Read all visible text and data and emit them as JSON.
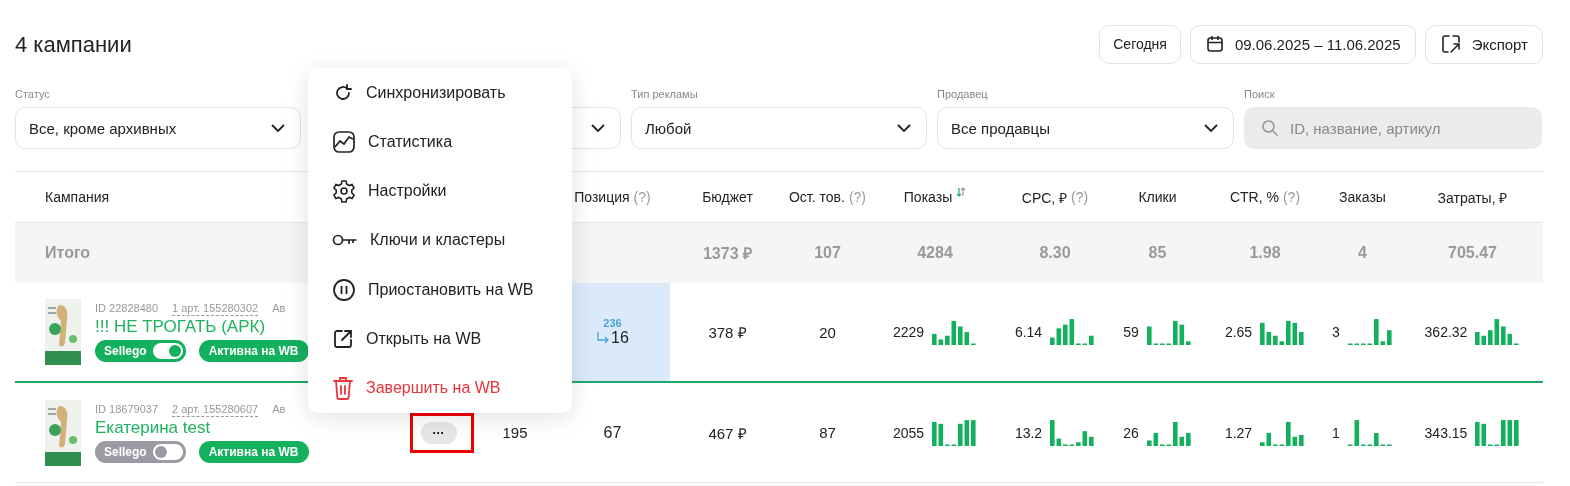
{
  "header": {
    "title": "4 кампании",
    "today_button": "Сегодня",
    "date_range": "09.06.2025 – 11.06.2025",
    "export_button": "Экспорт"
  },
  "filters": [
    {
      "kind": "select",
      "label": "Статус",
      "value": "Все, кроме архивных"
    },
    {
      "kind": "select"
    },
    {
      "kind": "select",
      "label": "Тип рекламы",
      "value": "Любой"
    },
    {
      "kind": "select",
      "label": "Продавец",
      "value": "Все продавцы"
    },
    {
      "kind": "search",
      "label": "Поиск",
      "placeholder": "ID, название, артикул"
    }
  ],
  "table": {
    "columns": [
      {
        "kind": "text",
        "label": "Кампания"
      },
      {
        "kind": "blank"
      },
      {
        "kind": "blank"
      },
      {
        "kind": "text",
        "label": "Позиция",
        "hint": "(?)"
      },
      {
        "kind": "text",
        "label": "Бюджет"
      },
      {
        "kind": "text",
        "label": "Ост. тов.",
        "hint": "(?)"
      },
      {
        "kind": "text",
        "label": "Показы",
        "sorted": true
      },
      {
        "kind": "text",
        "label": "CPC, ₽",
        "hint": "(?)"
      },
      {
        "kind": "text",
        "label": "Клики"
      },
      {
        "kind": "text",
        "label": "CTR, %",
        "hint": "(?)"
      },
      {
        "kind": "text",
        "label": "Заказы"
      },
      {
        "kind": "text",
        "label": "Затраты, ₽"
      }
    ],
    "totals": {
      "label": "Итого",
      "budget": "1373 ₽",
      "stock": "107",
      "impressions": "4284",
      "cpc": "8.30",
      "clicks": "85",
      "ctr": "1.98",
      "orders": "4",
      "spend": "705.47"
    },
    "rows": [
      {
        "selected": true,
        "id": "ID 22828480",
        "articles": "1 арт. 155280302",
        "type": "Ав",
        "name": "!!! НЕ ТРОГАТЬ (АРК)",
        "sellego": {
          "label": "Sellego",
          "on": true
        },
        "status": "Активна на WB",
        "position": {
          "previous": "236",
          "current": "16",
          "highlighted": true
        },
        "budget": "378 ₽",
        "stock": "20",
        "impressions": "2229",
        "cpc": "6.14",
        "clicks": "59",
        "ctr": "2.65",
        "orders": "3",
        "spend": "362.32"
      },
      {
        "selected": false,
        "id": "ID 18679037",
        "articles": "2 арт. 155280607",
        "type": "Ав",
        "name": "Екатерина test",
        "sellego": {
          "label": "Sellego",
          "on": false
        },
        "status": "Активна на WB",
        "more_button": {
          "label": "···",
          "highlighted": true
        },
        "column_3": "195",
        "position": {
          "current": "67",
          "highlighted": false
        },
        "budget": "467 ₽",
        "stock": "87",
        "impressions": "2055",
        "cpc": "13.2",
        "clicks": "26",
        "ctr": "1.27",
        "orders": "1",
        "spend": "343.15"
      }
    ]
  },
  "context_menu": {
    "items": [
      {
        "kind": "normal",
        "label": "Синхронизировать"
      },
      {
        "kind": "normal",
        "label": "Статистика"
      },
      {
        "kind": "normal",
        "label": "Настройки"
      },
      {
        "kind": "normal",
        "label": "Ключи и кластеры"
      },
      {
        "kind": "normal",
        "label": "Приостановить на WB"
      },
      {
        "kind": "normal",
        "label": "Открыть на WB"
      },
      {
        "kind": "danger",
        "label": "Завершить на WB"
      }
    ]
  }
}
